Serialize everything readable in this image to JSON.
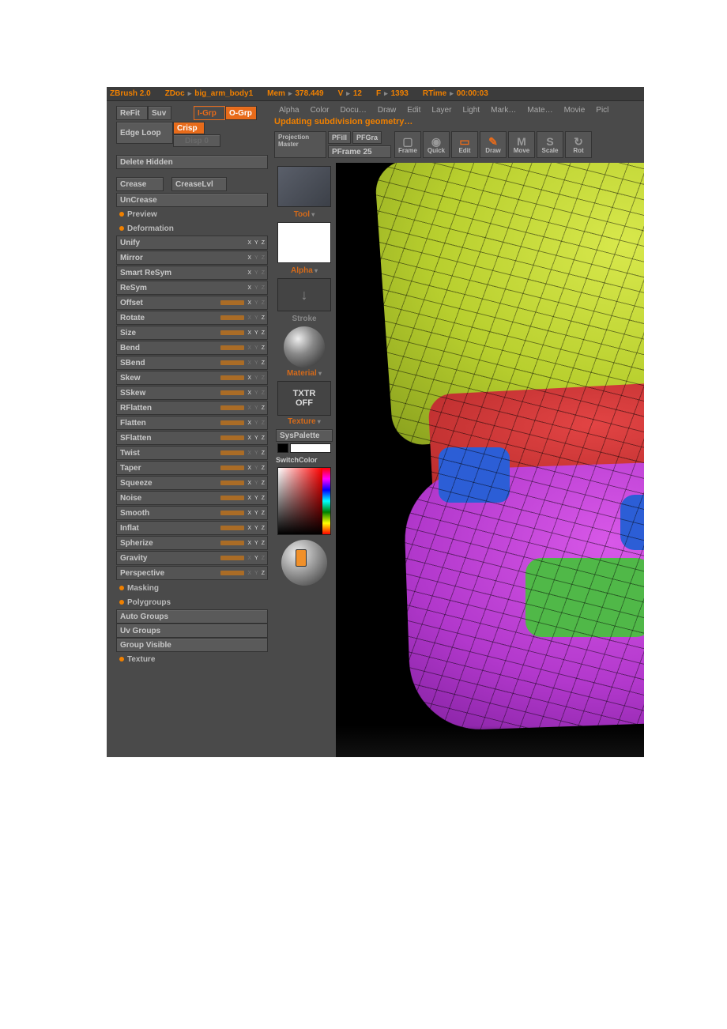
{
  "title": {
    "app": "ZBrush 2.0",
    "doc_label": "ZDoc",
    "doc_name": "big_arm_body1",
    "mem_label": "Mem",
    "mem_value": "378.449",
    "v_label": "V",
    "v_value": "12",
    "f_label": "F",
    "f_value": "1393",
    "rtime_label": "RTime",
    "rtime_value": "00:00:03"
  },
  "menus": [
    "Alpha",
    "Color",
    "Docu…",
    "Draw",
    "Edit",
    "Layer",
    "Light",
    "Mark…",
    "Mate…",
    "Movie",
    "Picl"
  ],
  "status": "Updating subdivision geometry…",
  "proj": {
    "projection": "Projection",
    "master": "Master",
    "pfill": "PFill",
    "pfgra": "PFGra",
    "pframe_label": "PFrame",
    "pframe_value": "25"
  },
  "mode_buttons": [
    "Frame",
    "Quick",
    "Edit",
    "Draw",
    "Move",
    "Scale",
    "Rot"
  ],
  "left": {
    "refit": "ReFit",
    "suv": "Suv",
    "igrp": "I-Grp",
    "ogrp": "O-Grp",
    "crisp": "Crisp",
    "edgeloop": "Edge Loop",
    "disp": "Disp 0",
    "delete_hidden": "Delete Hidden",
    "crease": "Crease",
    "crease_lvl": "CreaseLvl",
    "uncrease": "UnCrease",
    "preview": "Preview",
    "deformation": "Deformation",
    "masking": "Masking",
    "polygroups": "Polygroups",
    "auto_groups": "Auto Groups",
    "uv_groups": "Uv Groups",
    "group_visible": "Group Visible",
    "texture": "Texture"
  },
  "deform": [
    {
      "name": "Unify",
      "x": true,
      "y": true,
      "z": true,
      "slider": false
    },
    {
      "name": "Mirror",
      "x": true,
      "y": false,
      "z": false,
      "slider": false
    },
    {
      "name": "Smart ReSym",
      "x": true,
      "y": false,
      "z": false,
      "slider": false
    },
    {
      "name": "ReSym",
      "x": true,
      "y": false,
      "z": false,
      "slider": false
    },
    {
      "name": "Offset",
      "x": true,
      "y": false,
      "z": false,
      "slider": true
    },
    {
      "name": "Rotate",
      "x": false,
      "y": false,
      "z": true,
      "slider": true
    },
    {
      "name": "Size",
      "x": true,
      "y": true,
      "z": true,
      "slider": true
    },
    {
      "name": "Bend",
      "x": false,
      "y": false,
      "z": true,
      "slider": true
    },
    {
      "name": "SBend",
      "x": false,
      "y": false,
      "z": true,
      "slider": true
    },
    {
      "name": "Skew",
      "x": true,
      "y": false,
      "z": false,
      "slider": true
    },
    {
      "name": "SSkew",
      "x": true,
      "y": false,
      "z": false,
      "slider": true
    },
    {
      "name": "RFlatten",
      "x": false,
      "y": false,
      "z": true,
      "slider": true
    },
    {
      "name": "Flatten",
      "x": true,
      "y": false,
      "z": false,
      "slider": true
    },
    {
      "name": "SFlatten",
      "x": true,
      "y": true,
      "z": true,
      "slider": true
    },
    {
      "name": "Twist",
      "x": false,
      "y": false,
      "z": true,
      "slider": true
    },
    {
      "name": "Taper",
      "x": true,
      "y": false,
      "z": true,
      "slider": true
    },
    {
      "name": "Squeeze",
      "x": true,
      "y": false,
      "z": true,
      "slider": true
    },
    {
      "name": "Noise",
      "x": true,
      "y": true,
      "z": true,
      "slider": true
    },
    {
      "name": "Smooth",
      "x": true,
      "y": true,
      "z": true,
      "slider": true
    },
    {
      "name": "Inflat",
      "x": true,
      "y": true,
      "z": true,
      "slider": true
    },
    {
      "name": "Spherize",
      "x": true,
      "y": true,
      "z": true,
      "slider": true
    },
    {
      "name": "Gravity",
      "x": false,
      "y": true,
      "z": false,
      "slider": true
    },
    {
      "name": "Perspective",
      "x": false,
      "y": false,
      "z": true,
      "slider": true
    }
  ],
  "shelf": {
    "tool": "Tool",
    "alpha": "Alpha",
    "stroke": "Stroke",
    "material": "Material",
    "txtr1": "TXTR",
    "txtr2": "OFF",
    "texture": "Texture",
    "syspalette": "SysPalette",
    "switchcolor": "SwitchColor"
  }
}
